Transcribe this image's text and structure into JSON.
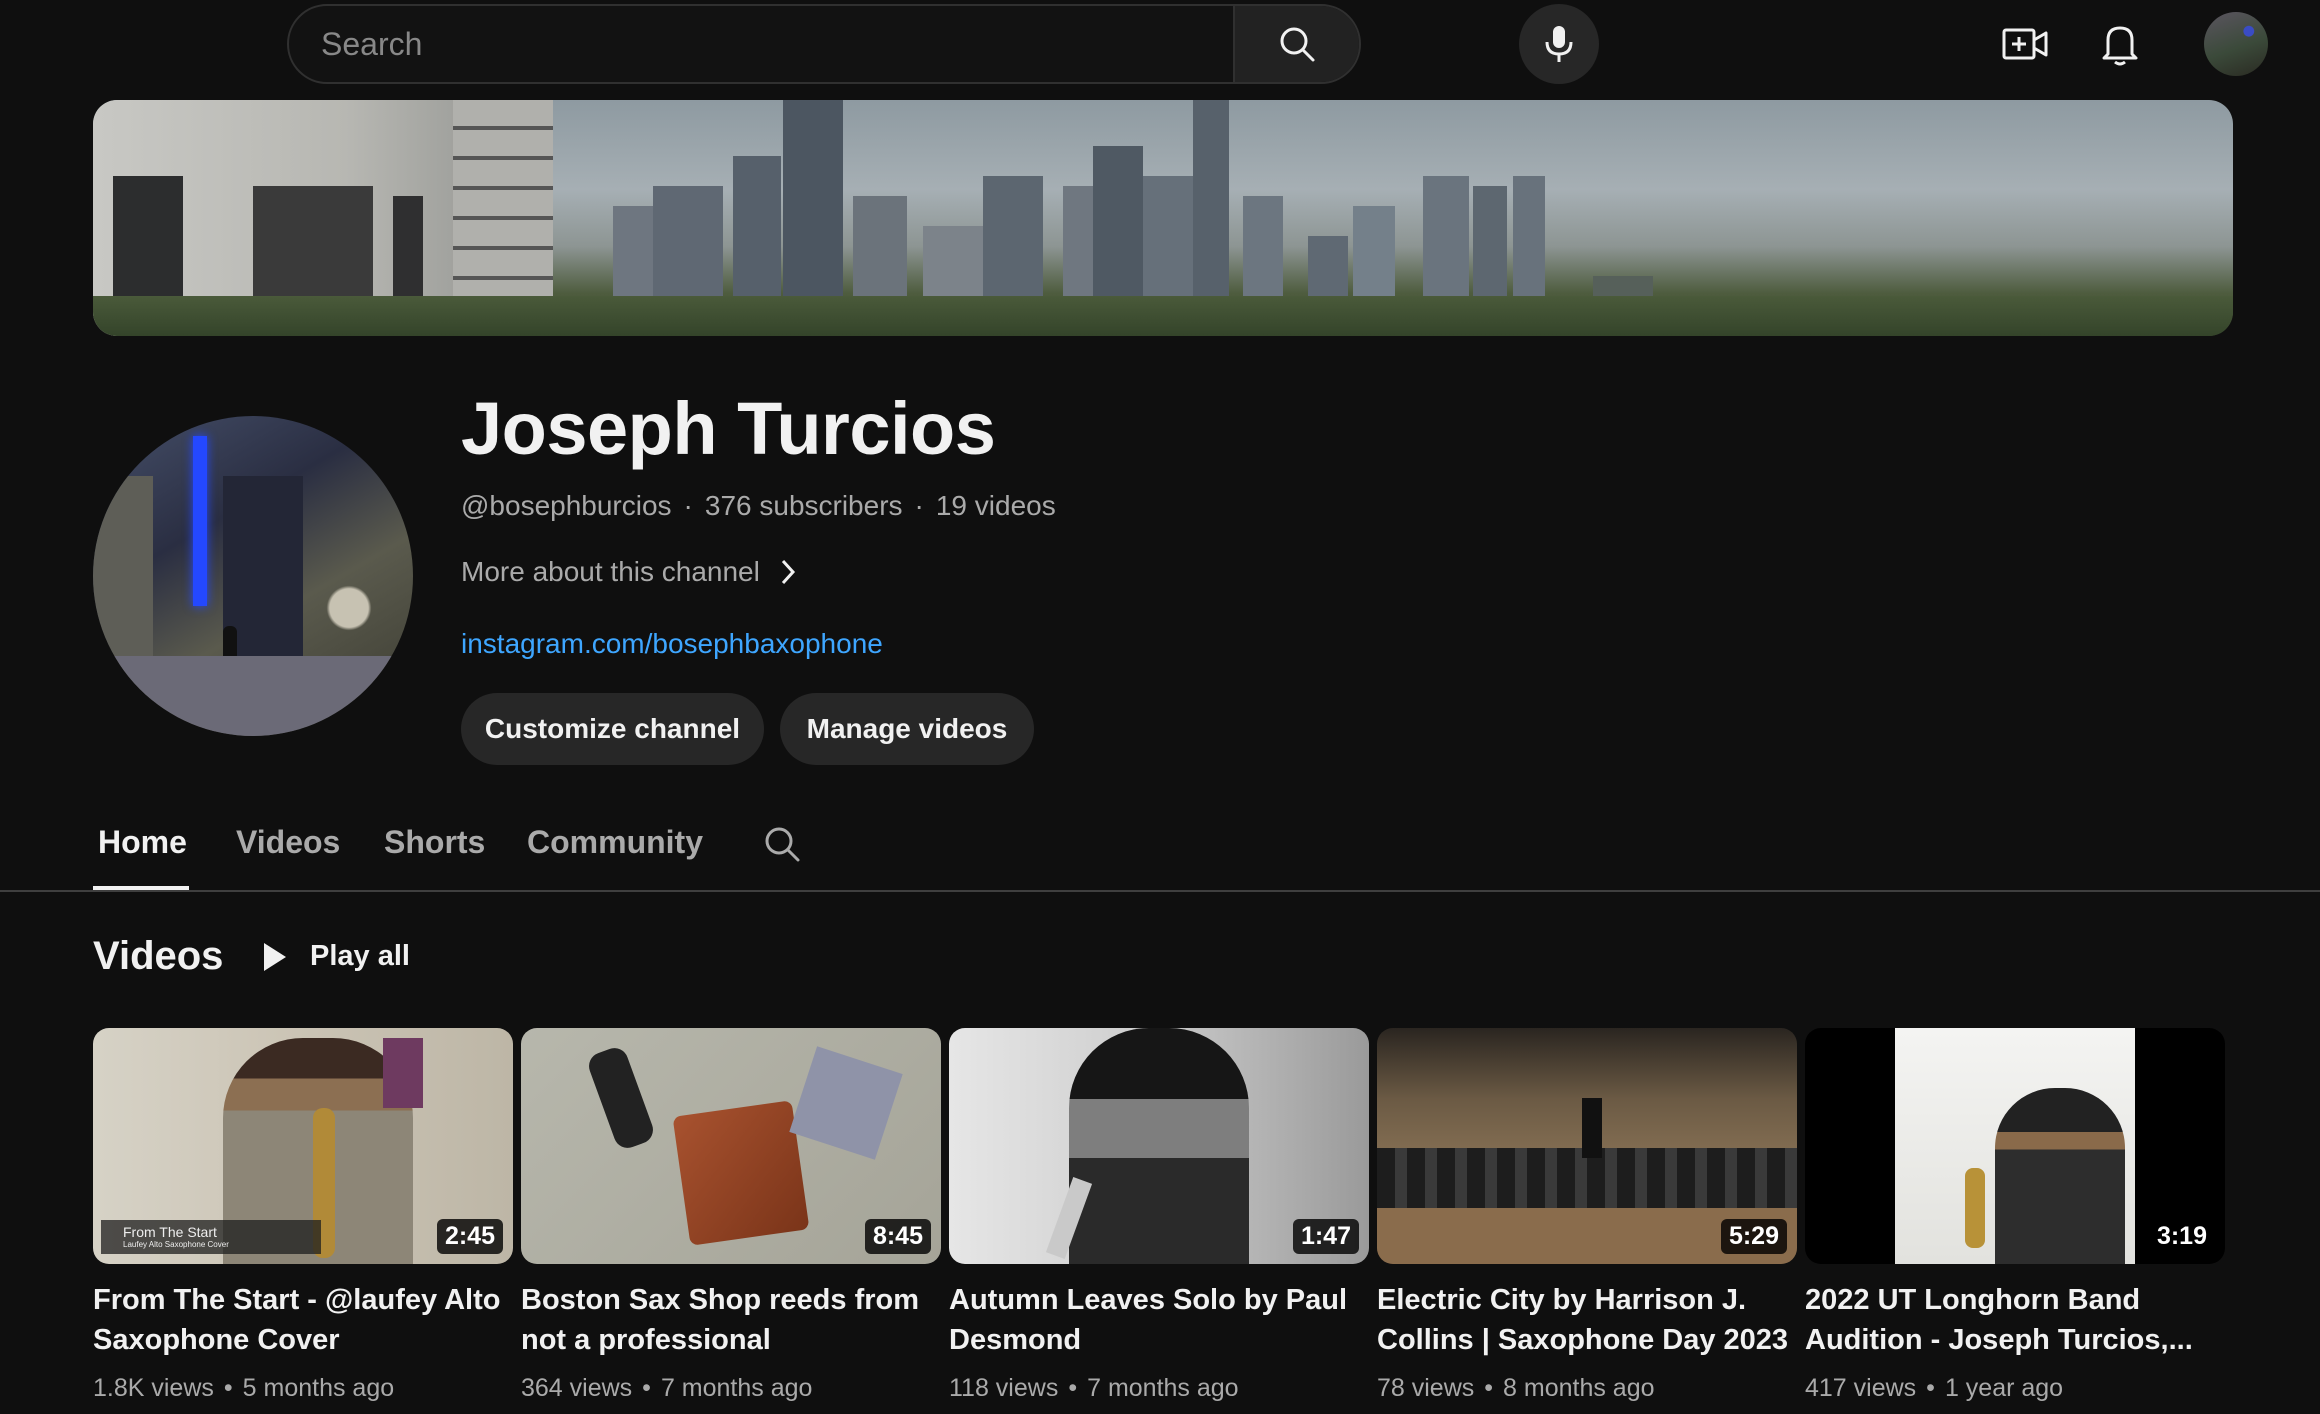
{
  "topbar": {
    "search_placeholder": "Search",
    "icons": [
      "search-icon",
      "mic-icon",
      "create-video-icon",
      "bell-icon",
      "account-avatar"
    ]
  },
  "channel": {
    "name": "Joseph Turcios",
    "handle": "@bosephburcios",
    "subscribers": "376 subscribers",
    "videos_count": "19 videos",
    "more_about": "More about this channel",
    "link": "instagram.com/bosephbaxophone",
    "customize_label": "Customize channel",
    "manage_label": "Manage videos"
  },
  "tabs": [
    {
      "label": "Home",
      "active": true
    },
    {
      "label": "Videos",
      "active": false
    },
    {
      "label": "Shorts",
      "active": false
    },
    {
      "label": "Community",
      "active": false
    }
  ],
  "section": {
    "title": "Videos",
    "play_all": "Play all"
  },
  "videos": [
    {
      "title": "From The Start - @laufey Alto Saxophone Cover",
      "duration": "2:45",
      "views": "1.8K views",
      "age": "5 months ago",
      "thumb_caption": "From The Start",
      "thumb_subcaption": "Laufey Alto Saxophone Cover"
    },
    {
      "title": "Boston Sax Shop reeds from not a professional",
      "duration": "8:45",
      "views": "364 views",
      "age": "7 months ago"
    },
    {
      "title": "Autumn Leaves Solo by Paul Desmond",
      "duration": "1:47",
      "views": "118 views",
      "age": "7 months ago"
    },
    {
      "title": "Electric City by Harrison J. Collins | Saxophone Day 2023",
      "duration": "5:29",
      "views": "78 views",
      "age": "8 months ago"
    },
    {
      "title": "2022 UT Longhorn Band Audition - Joseph Turcios,...",
      "duration": "3:19",
      "views": "417 views",
      "age": "1 year ago"
    }
  ],
  "colors": {
    "background": "#0f0f0f",
    "link": "#3ea6ff",
    "secondary_text": "#aaaaaa",
    "button_bg": "#272727"
  }
}
